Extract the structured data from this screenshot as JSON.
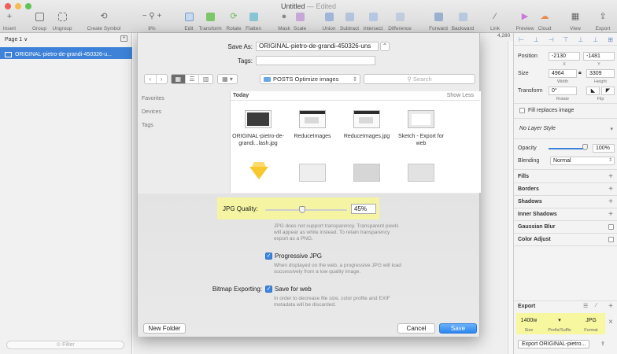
{
  "window": {
    "title": "Untitled",
    "edited": "— Edited"
  },
  "toolbar": {
    "insert": "Insert",
    "group": "Group",
    "ungroup": "Ungroup",
    "create_symbol": "Create Symbol",
    "zoom_minus": "−",
    "zoom_plus": "+",
    "zoom_value": "8%",
    "edit": "Edit",
    "transform": "Transform",
    "rotate": "Rotate",
    "flatten": "Flatten",
    "mask": "Mask",
    "scale": "Scale",
    "union": "Union",
    "subtract": "Subtract",
    "intersect": "Intersect",
    "difference": "Difference",
    "forward": "Forward",
    "backward": "Backward",
    "link": "Link",
    "preview": "Preview",
    "cloud": "Cloud",
    "view": "View",
    "export": "Export"
  },
  "layers": {
    "page": "Page 1 ∨",
    "item": "ORIGINAL-pietro-de-grandi-450326-u...",
    "filter_placeholder": "Filter"
  },
  "ruler": {
    "value": "4,280"
  },
  "dialog": {
    "save_as_label": "Save As:",
    "save_as_value": "ORIGINAL-pietro-de-grandi-450326-uns",
    "expand": "⌃",
    "tags_label": "Tags:",
    "folder": "POSTS Optimize images",
    "search_placeholder": "Search",
    "sidebar": [
      "Favorites",
      "Devices",
      "Tags"
    ],
    "today": "Today",
    "show_less": "Show Less",
    "files": [
      "ORIGINAL-pietro-de-grandi...lash.jpg",
      "ReduceImages",
      "ReduceImages.jpg",
      "Sketch - Export for web"
    ],
    "jpg_quality_label": "JPG Quality:",
    "jpg_quality_value": "45%",
    "quality_fraction": 0.45,
    "quality_note": "JPG does not support transparency. Transparent pixels will appear as white instead. To retain transparency export as a PNG.",
    "progressive_label": "Progressive JPG",
    "progressive_note": "When displayed on the web, a progressive JPG will load successively from a low quality image.",
    "bitmap_label": "Bitmap Exporting:",
    "save_web_label": "Save for web",
    "save_web_note": "In order to decrease file size, color profile and EXIF metadata will be discarded.",
    "new_folder": "New Folder",
    "cancel": "Cancel",
    "save": "Save"
  },
  "inspector": {
    "position_label": "Position",
    "x_value": "-2130",
    "y_value": "-1481",
    "x_sub": "X",
    "y_sub": "Y",
    "size_label": "Size",
    "width_value": "4964",
    "height_value": "3309",
    "width_sub": "Width",
    "height_sub": "Height",
    "transform_label": "Transform",
    "rotate_value": "0°",
    "rotate_sub": "Rotate",
    "flip_sub": "Flip",
    "fill_replaces": "Fill replaces image",
    "layer_style": "No Layer Style",
    "opacity_label": "Opacity",
    "opacity_value": "100%",
    "blending_label": "Blending",
    "blending_value": "Normal",
    "sections": [
      "Fills",
      "Borders",
      "Shadows",
      "Inner Shadows",
      "Gaussian Blur",
      "Color Adjust"
    ],
    "export_label": "Export",
    "export_size": "1400w",
    "export_suffix": "",
    "export_format": "JPG",
    "export_size_sub": "Size",
    "export_suffix_sub": "Prefix/Suffix",
    "export_format_sub": "Format",
    "export_button": "Export ORIGINAL-pietro..."
  },
  "colors": {
    "accent": "#3d82d8",
    "highlight": "#f7f796",
    "save_button": "#2e86ef"
  }
}
